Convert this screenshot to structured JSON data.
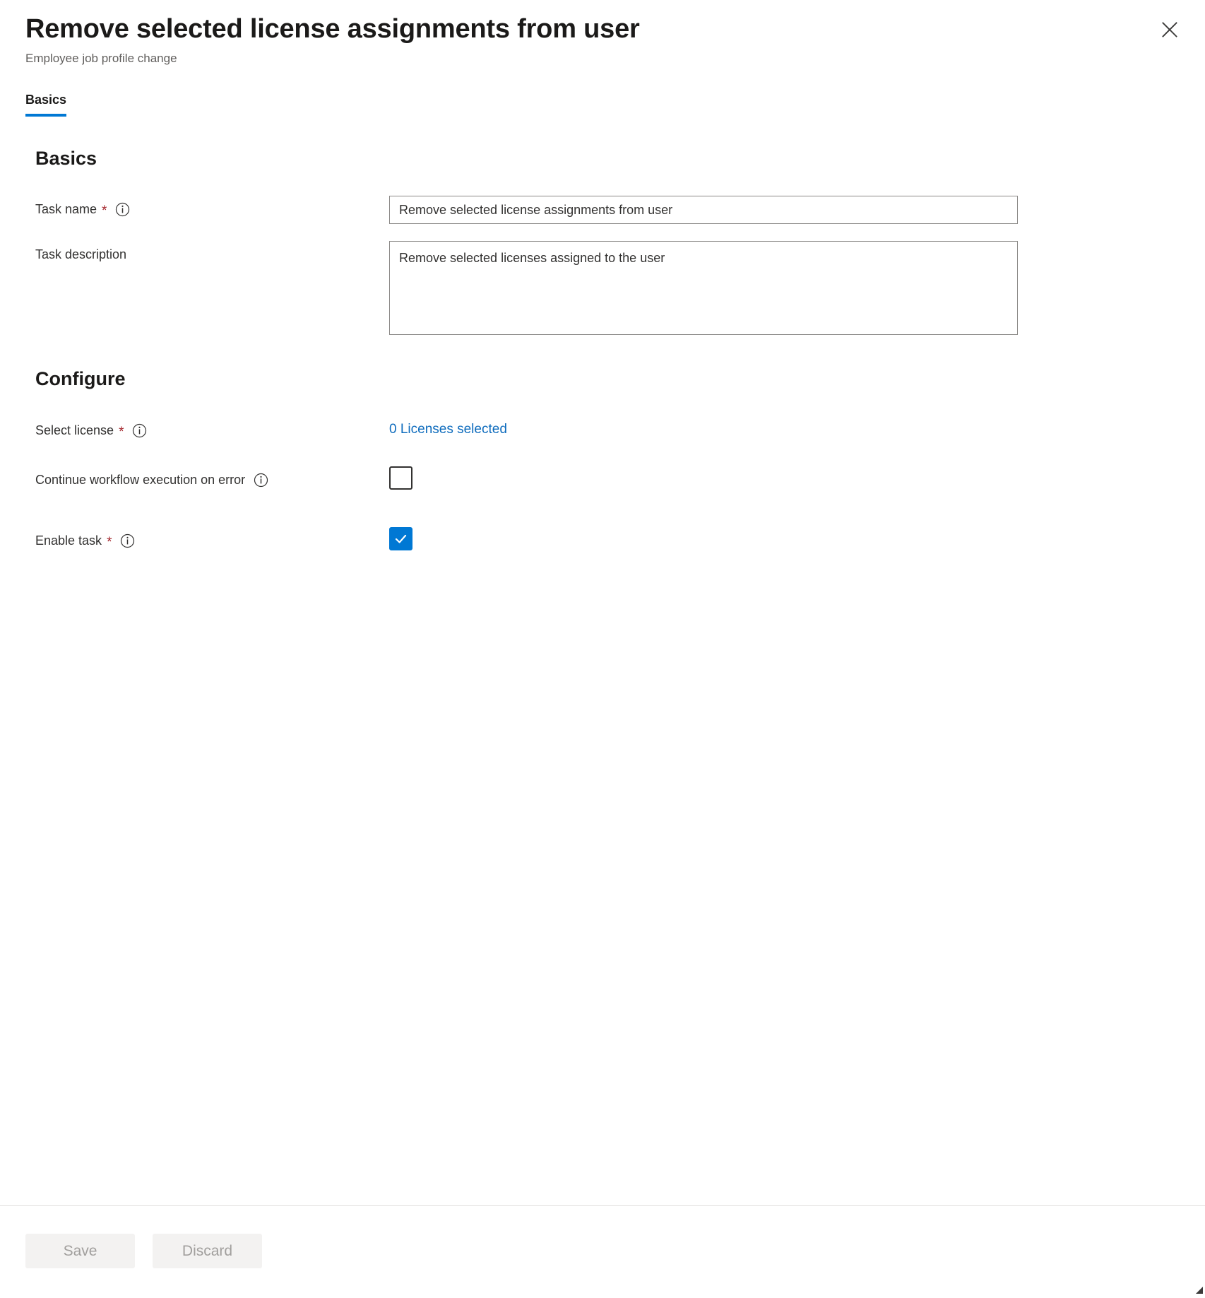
{
  "header": {
    "title": "Remove selected license assignments from user",
    "subtitle": "Employee job profile change",
    "close_label": "Close",
    "close_icon": "close-icon"
  },
  "tabs": [
    {
      "label": "Basics",
      "active": true
    }
  ],
  "sections": {
    "basics": {
      "heading": "Basics",
      "task_name": {
        "label": "Task name",
        "required_marker": "*",
        "info_icon": "info-icon",
        "value": "Remove selected license assignments from user",
        "placeholder": ""
      },
      "task_description": {
        "label": "Task description",
        "value": "Remove selected licenses assigned to the user",
        "placeholder": ""
      }
    },
    "configure": {
      "heading": "Configure",
      "select_license": {
        "label": "Select license",
        "required_marker": "*",
        "info_icon": "info-icon",
        "link_text": "0 Licenses selected",
        "link_color": "#0f6cbd"
      },
      "continue_on_error": {
        "label": "Continue workflow execution on error",
        "info_icon": "info-icon",
        "checked": false
      },
      "enable_task": {
        "label": "Enable task",
        "required_marker": "*",
        "info_icon": "info-icon",
        "checked": true
      }
    }
  },
  "footer": {
    "save_label": "Save",
    "discard_label": "Discard",
    "save_enabled": false,
    "discard_enabled": false
  },
  "colors": {
    "accent": "#0078d4",
    "link": "#0f6cbd",
    "required": "#a4262c",
    "border": "#8a8886",
    "disabled_bg": "#f3f2f1",
    "disabled_text": "#a19f9d"
  }
}
